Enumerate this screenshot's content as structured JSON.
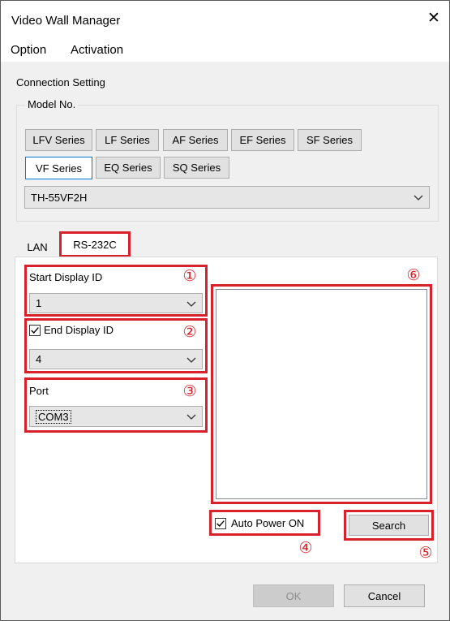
{
  "window": {
    "title": "Video Wall Manager",
    "close_glyph": "✕"
  },
  "menu": {
    "items": [
      "Option",
      "Activation"
    ]
  },
  "connection": {
    "section_label": "Connection Setting",
    "model_group_label": "Model No.",
    "series_buttons": [
      "LFV Series",
      "LF Series",
      "AF Series",
      "EF Series",
      "SF Series",
      "VF Series",
      "EQ Series",
      "SQ Series"
    ],
    "selected_series": "VF Series",
    "model_value": "TH-55VF2H"
  },
  "tabs": {
    "items": [
      "LAN",
      "RS-232C"
    ],
    "active": "RS-232C"
  },
  "rs232": {
    "start_display_id": {
      "label": "Start Display ID",
      "value": "1"
    },
    "end_display_id": {
      "label": "End Display ID",
      "checked": true,
      "value": "4"
    },
    "port": {
      "label": "Port",
      "value": "COM3"
    },
    "auto_power": {
      "label": "Auto Power ON",
      "checked": true
    },
    "search_label": "Search"
  },
  "callouts": [
    "①",
    "②",
    "③",
    "④",
    "⑤",
    "⑥"
  ],
  "footer": {
    "ok_label": "OK",
    "cancel_label": "Cancel",
    "ok_enabled": false
  },
  "colors": {
    "highlight": "#d9212b",
    "accent": "#0078d7"
  }
}
